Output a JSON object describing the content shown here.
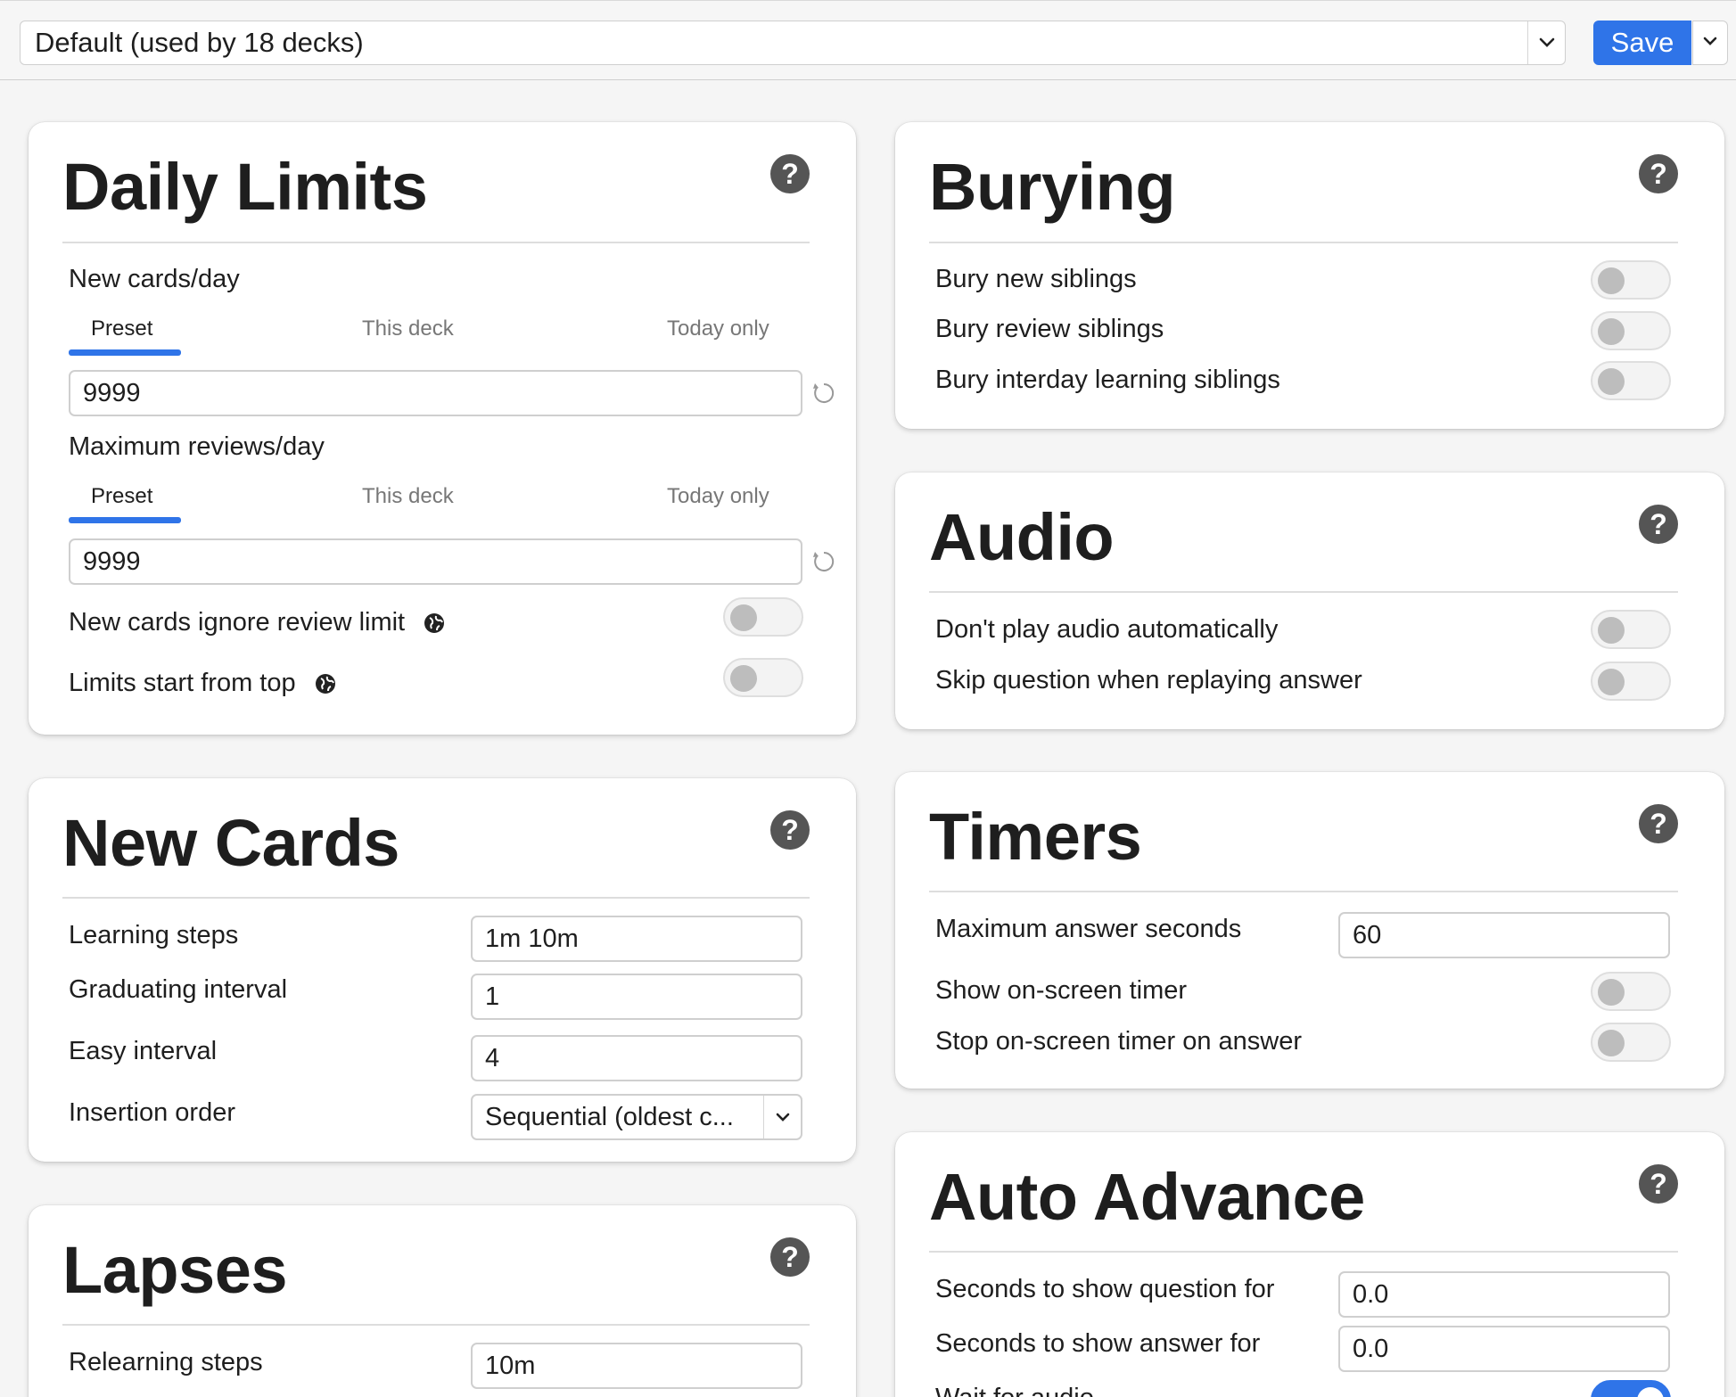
{
  "toolbar": {
    "preset_value": "Default (used by 18 decks)",
    "save_label": "Save"
  },
  "colors": {
    "accent": "#2f74e8",
    "help_icon": "#555555"
  },
  "daily_limits": {
    "title": "Daily Limits",
    "help_icon": "?",
    "new_cards": {
      "label": "New cards/day",
      "tabs": [
        "Preset",
        "This deck",
        "Today only"
      ],
      "active_tab": "Preset",
      "value": "9999"
    },
    "max_reviews": {
      "label": "Maximum reviews/day",
      "tabs": [
        "Preset",
        "This deck",
        "Today only"
      ],
      "active_tab": "Preset",
      "value": "9999"
    },
    "ignore_review_limit": {
      "label": "New cards ignore review limit",
      "on": false
    },
    "limits_from_top": {
      "label": "Limits start from top",
      "on": false
    }
  },
  "new_cards": {
    "title": "New Cards",
    "help_icon": "?",
    "learning_steps": {
      "label": "Learning steps",
      "value": "1m 10m"
    },
    "graduating_interval": {
      "label": "Graduating interval",
      "value": "1"
    },
    "easy_interval": {
      "label": "Easy interval",
      "value": "4"
    },
    "insertion_order": {
      "label": "Insertion order",
      "value": "Sequential (oldest c..."
    }
  },
  "lapses": {
    "title": "Lapses",
    "help_icon": "?",
    "relearning_steps": {
      "label": "Relearning steps",
      "value": "10m"
    }
  },
  "burying": {
    "title": "Burying",
    "help_icon": "?",
    "items": [
      {
        "label": "Bury new siblings",
        "on": false
      },
      {
        "label": "Bury review siblings",
        "on": false
      },
      {
        "label": "Bury interday learning siblings",
        "on": false
      }
    ]
  },
  "audio": {
    "title": "Audio",
    "help_icon": "?",
    "items": [
      {
        "label": "Don't play audio automatically",
        "on": false
      },
      {
        "label": "Skip question when replaying answer",
        "on": false
      }
    ]
  },
  "timers": {
    "title": "Timers",
    "help_icon": "?",
    "max_answer_seconds": {
      "label": "Maximum answer seconds",
      "value": "60"
    },
    "show_timer": {
      "label": "Show on-screen timer",
      "on": false
    },
    "stop_timer": {
      "label": "Stop on-screen timer on answer",
      "on": false
    }
  },
  "auto_advance": {
    "title": "Auto Advance",
    "help_icon": "?",
    "question_seconds": {
      "label": "Seconds to show question for",
      "value": "0.0"
    },
    "answer_seconds": {
      "label": "Seconds to show answer for",
      "value": "0.0"
    },
    "wait_for_audio": {
      "label": "Wait for audio",
      "on": true
    }
  }
}
